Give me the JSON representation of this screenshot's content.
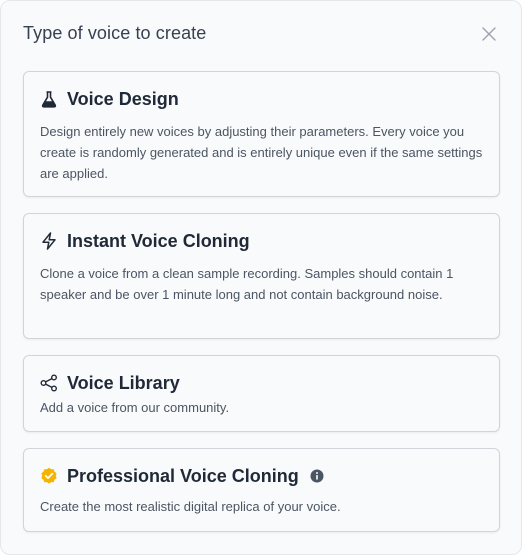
{
  "dialog": {
    "title": "Type of voice to create"
  },
  "options": [
    {
      "title": "Voice Design",
      "description": "Design entirely new voices by adjusting their parameters. Every voice you create is randomly generated and is entirely unique even if the same settings are applied.",
      "icon": "flask-icon"
    },
    {
      "title": "Instant Voice Cloning",
      "description": "Clone a voice from a clean sample recording. Samples should contain 1 speaker and be over 1 minute long and not contain background noise.",
      "icon": "lightning-icon"
    },
    {
      "title": "Voice Library",
      "description": "Add a voice from our community.",
      "icon": "share-icon"
    },
    {
      "title": "Professional Voice Cloning",
      "description": "Create the most realistic digital replica of your voice.",
      "icon": "verified-badge-icon",
      "info_icon": "info-icon"
    }
  ],
  "colors": {
    "verified_badge": "#f4b400",
    "text_primary": "#1f2937",
    "text_secondary": "#4b5563"
  }
}
